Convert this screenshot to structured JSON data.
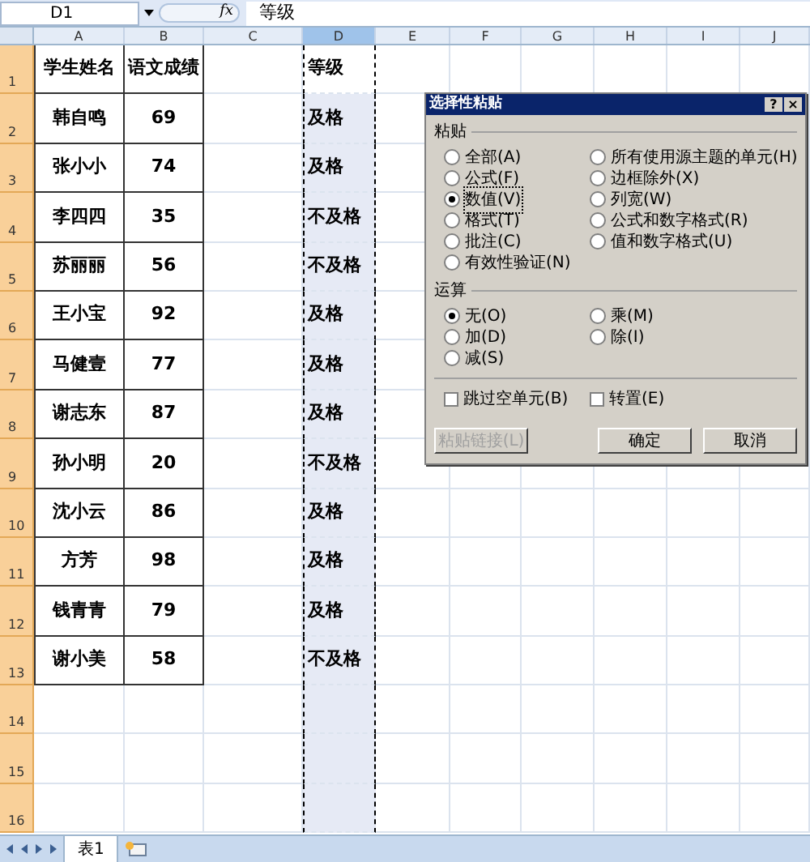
{
  "formula_bar": {
    "name_box": "D1",
    "fx": "fx",
    "formula": "等级"
  },
  "columns": [
    {
      "label": "A",
      "selected": false
    },
    {
      "label": "B",
      "selected": false
    },
    {
      "label": "C",
      "selected": false
    },
    {
      "label": "D",
      "selected": true
    },
    {
      "label": "E",
      "selected": false
    },
    {
      "label": "F",
      "selected": false
    },
    {
      "label": "G",
      "selected": false
    },
    {
      "label": "H",
      "selected": false
    },
    {
      "label": "I",
      "selected": false
    },
    {
      "label": "J",
      "selected": false
    }
  ],
  "rows": [
    {
      "header": "1",
      "name": "学生姓名",
      "score": "语文成绩",
      "grade": "等级",
      "active": true
    },
    {
      "header": "2",
      "name": "韩自鸣",
      "score": "69",
      "grade": "及格",
      "active": false
    },
    {
      "header": "3",
      "name": "张小小",
      "score": "74",
      "grade": "及格",
      "active": false
    },
    {
      "header": "4",
      "name": "李四四",
      "score": "35",
      "grade": "不及格",
      "active": false
    },
    {
      "header": "5",
      "name": "苏丽丽",
      "score": "56",
      "grade": "不及格",
      "active": false
    },
    {
      "header": "6",
      "name": "王小宝",
      "score": "92",
      "grade": "及格",
      "active": false
    },
    {
      "header": "7",
      "name": "马健壹",
      "score": "77",
      "grade": "及格",
      "active": false
    },
    {
      "header": "8",
      "name": "谢志东",
      "score": "87",
      "grade": "及格",
      "active": false
    },
    {
      "header": "9",
      "name": "孙小明",
      "score": "20",
      "grade": "不及格",
      "active": false
    },
    {
      "header": "10",
      "name": "沈小云",
      "score": "86",
      "grade": "及格",
      "active": false
    },
    {
      "header": "11",
      "name": "方芳",
      "score": "98",
      "grade": "及格",
      "active": false
    },
    {
      "header": "12",
      "name": "钱青青",
      "score": "79",
      "grade": "及格",
      "active": false
    },
    {
      "header": "13",
      "name": "谢小美",
      "score": "58",
      "grade": "不及格",
      "active": false
    },
    {
      "header": "14",
      "active": false
    },
    {
      "header": "15",
      "active": false
    },
    {
      "header": "16",
      "active": false
    }
  ],
  "dialog": {
    "title": "选择性粘贴",
    "help": "?",
    "close": "×",
    "paste": {
      "label": "粘贴",
      "options": [
        {
          "label": "全部(A)",
          "selected": false
        },
        {
          "label": "公式(F)",
          "selected": false
        },
        {
          "label": "数值(V)",
          "selected": true
        },
        {
          "label": "格式(T)",
          "selected": false
        },
        {
          "label": "批注(C)",
          "selected": false
        },
        {
          "label": "有效性验证(N)",
          "selected": false
        },
        {
          "label": "所有使用源主题的单元(H)",
          "selected": false
        },
        {
          "label": "边框除外(X)",
          "selected": false
        },
        {
          "label": "列宽(W)",
          "selected": false
        },
        {
          "label": "公式和数字格式(R)",
          "selected": false
        },
        {
          "label": "值和数字格式(U)",
          "selected": false
        }
      ]
    },
    "operation": {
      "label": "运算",
      "options": [
        {
          "label": "无(O)",
          "selected": true
        },
        {
          "label": "加(D)",
          "selected": false
        },
        {
          "label": "减(S)",
          "selected": false
        },
        {
          "label": "乘(M)",
          "selected": false
        },
        {
          "label": "除(I)",
          "selected": false
        }
      ]
    },
    "checkboxes": [
      {
        "label": "跳过空单元(B)",
        "checked": false
      },
      {
        "label": "转置(E)",
        "checked": false
      }
    ],
    "buttons": [
      {
        "label": "粘贴链接(L)",
        "disabled": true
      },
      {
        "label": "确定",
        "disabled": false
      },
      {
        "label": "取消",
        "disabled": false
      }
    ]
  },
  "sheet_tabs": [
    {
      "label": "表1",
      "selected": true
    }
  ]
}
